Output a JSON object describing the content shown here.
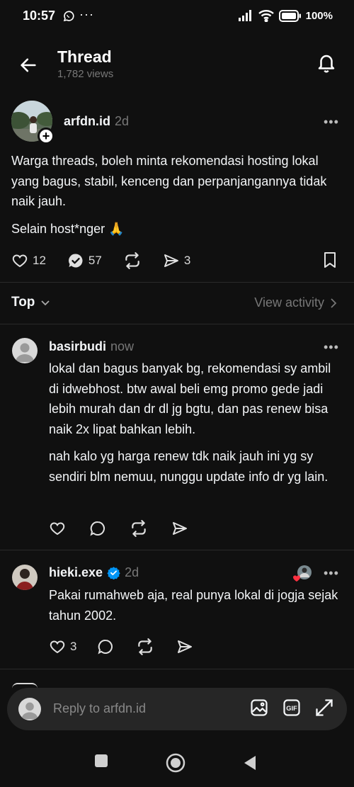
{
  "status": {
    "time": "10:57",
    "battery": "100%"
  },
  "header": {
    "title": "Thread",
    "views": "1,782 views"
  },
  "post": {
    "author": "arfdn.id",
    "time": "2d",
    "paragraphs": [
      "Warga threads, boleh minta rekomendasi hosting lokal yang bagus, stabil, kenceng dan perpanjangannya tidak naik jauh.",
      "Selain host*nger 🙏"
    ],
    "likes": "12",
    "replies": "57",
    "shares": "3"
  },
  "sort": {
    "label": "Top",
    "view_activity": "View activity"
  },
  "replies": [
    {
      "author": "basirbudi",
      "time": "now",
      "paragraphs": [
        "lokal dan bagus banyak bg, rekomendasi sy ambil di idwebhost. btw awal beli emg promo gede jadi lebih murah dan dr dl jg bgtu, dan pas renew bisa naik 2x lipat bahkan lebih.",
        "nah kalo yg harga renew tdk naik jauh ini yg sy sendiri blm nemuu, nunggu update info dr yg lain."
      ],
      "likes": ""
    },
    {
      "author": "hieki.exe",
      "time": "2d",
      "paragraphs": [
        "Pakai rumahweb aja, real punya lokal di jogja sejak tahun 2002."
      ],
      "likes": "3"
    }
  ],
  "composer": {
    "placeholder": "Reply to arfdn.id"
  },
  "icons": {
    "back": "arrow-left-icon",
    "bell": "bell-icon",
    "heart": "heart-icon",
    "reply": "reply-icon",
    "repost": "repost-icon",
    "share": "share-icon",
    "bookmark": "bookmark-icon",
    "verified": "verified-icon",
    "image": "image-icon",
    "gif": "gif-icon",
    "expand": "expand-icon"
  },
  "colors": {
    "background": "#101010",
    "verified": "#0095f6",
    "muted": "#777777"
  }
}
